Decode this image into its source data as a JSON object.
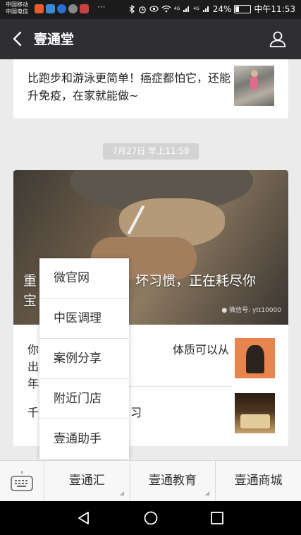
{
  "status_bar": {
    "carrier1": "中国移动",
    "carrier2": "中国电信",
    "signal_badge1": "4G",
    "signal_badge2": "4G",
    "battery_percent": "24%",
    "battery_level": 0.24,
    "time": "中午11:53"
  },
  "navbar": {
    "title": "壹通堂"
  },
  "messages": [
    {
      "article_title": "比跑步和游泳更简单！癌症都怕它，还能升免疫，在家就能做~"
    }
  ],
  "timestamp": "7月27日 早上11:58",
  "news_card": {
    "hero_title": "重……坏习惯，正在耗尽你宝……",
    "hero_title_left": "重",
    "hero_title_right": "坏习惯，正在耗尽你",
    "hero_title_line2": "宝",
    "watermark": "微信号: ytt10000",
    "items": [
      {
        "text_left": "你",
        "text_right": "体质可以从出生",
        "text_line2": "年"
      },
      {
        "text_left": "千",
        "text_right": "习"
      }
    ]
  },
  "popup_menu": {
    "items": [
      "微官网",
      "中医调理",
      "案例分享",
      "附近门店",
      "壹通助手"
    ]
  },
  "bottom_menu": {
    "items": [
      "壹通汇",
      "壹通教育",
      "壹通商城"
    ]
  }
}
